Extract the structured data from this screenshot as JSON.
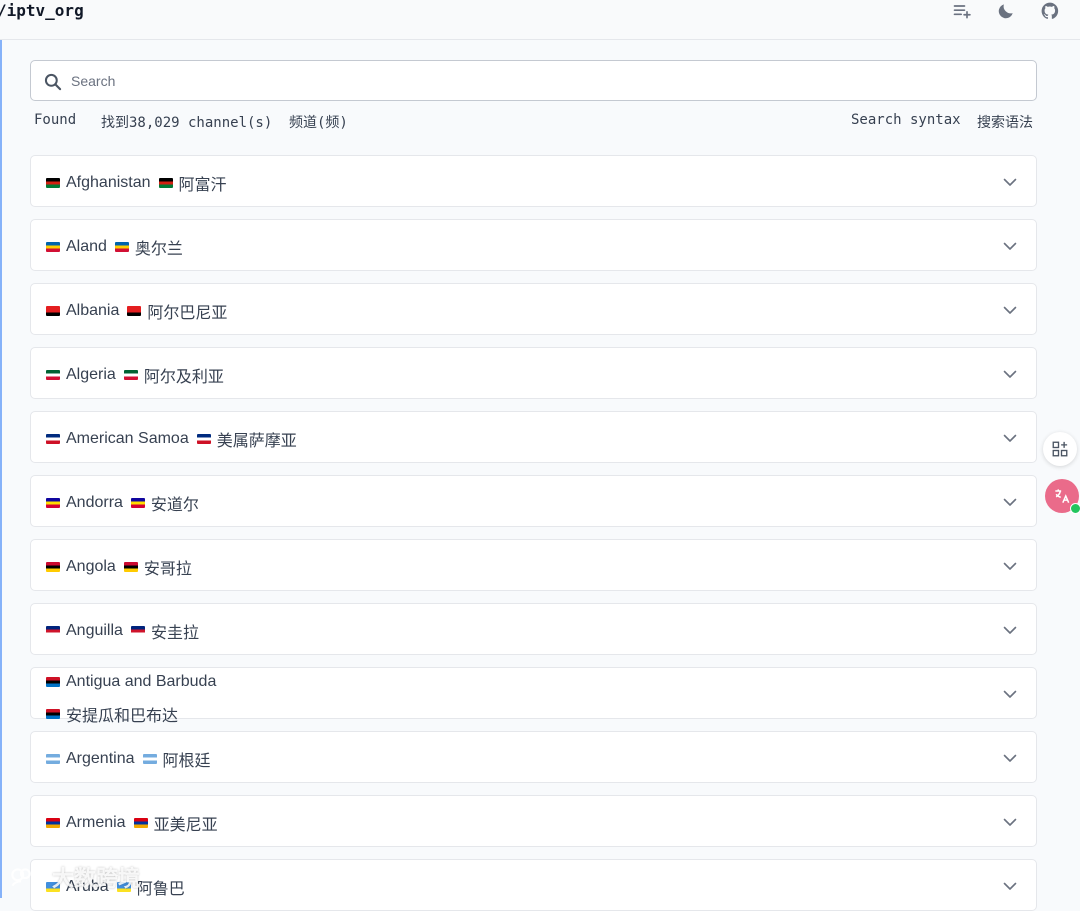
{
  "header": {
    "brand": "/iptv_org",
    "icons": [
      "playlist-add-icon",
      "moon-icon",
      "github-icon"
    ]
  },
  "search": {
    "placeholder": "Search"
  },
  "status": {
    "found": "Found",
    "count_zh": "找到38,029 channel(s)",
    "channels_zh": "频道(频)",
    "syntax": "Search syntax",
    "syntax_zh": "搜索语法"
  },
  "countries": [
    {
      "name": "Afghanistan",
      "name_zh": "阿富汗",
      "flag": [
        "#000000",
        "#d32011",
        "#007a36"
      ]
    },
    {
      "name": "Aland",
      "name_zh": "奥尔兰",
      "flag": [
        "#0064ad",
        "#ffce00",
        "#d21034"
      ]
    },
    {
      "name": "Albania",
      "name_zh": "阿尔巴尼亚",
      "flag": [
        "#e41e20",
        "#e41e20",
        "#000000"
      ]
    },
    {
      "name": "Algeria",
      "name_zh": "阿尔及利亚",
      "flag": [
        "#006233",
        "#ffffff",
        "#d21034"
      ]
    },
    {
      "name": "American Samoa",
      "name_zh": "美属萨摩亚",
      "flag": [
        "#002b7f",
        "#ffffff",
        "#ce1126"
      ]
    },
    {
      "name": "Andorra",
      "name_zh": "安道尔",
      "flag": [
        "#10069f",
        "#fedd00",
        "#d50032"
      ]
    },
    {
      "name": "Angola",
      "name_zh": "安哥拉",
      "flag": [
        "#cc092f",
        "#000000",
        "#ffcb00"
      ]
    },
    {
      "name": "Anguilla",
      "name_zh": "安圭拉",
      "flag": [
        "#00247d",
        "#cf142b",
        "#ffffff"
      ]
    },
    {
      "name": "Antigua and Barbuda",
      "name_zh": "安提瓜和巴布达",
      "flag": [
        "#ce1126",
        "#000000",
        "#0072c6"
      ]
    },
    {
      "name": "Argentina",
      "name_zh": "阿根廷",
      "flag": [
        "#74acdf",
        "#ffffff",
        "#74acdf"
      ]
    },
    {
      "name": "Armenia",
      "name_zh": "亚美尼亚",
      "flag": [
        "#d90012",
        "#0033a0",
        "#f2a800"
      ]
    },
    {
      "name": "Aruba",
      "name_zh": "阿鲁巴",
      "flag": [
        "#418fde",
        "#418fde",
        "#fbe122"
      ]
    }
  ],
  "watermark": "大数跨境",
  "colors": {
    "accent": "#3b82f6",
    "border": "#e5e7eb",
    "text": "#374151"
  }
}
